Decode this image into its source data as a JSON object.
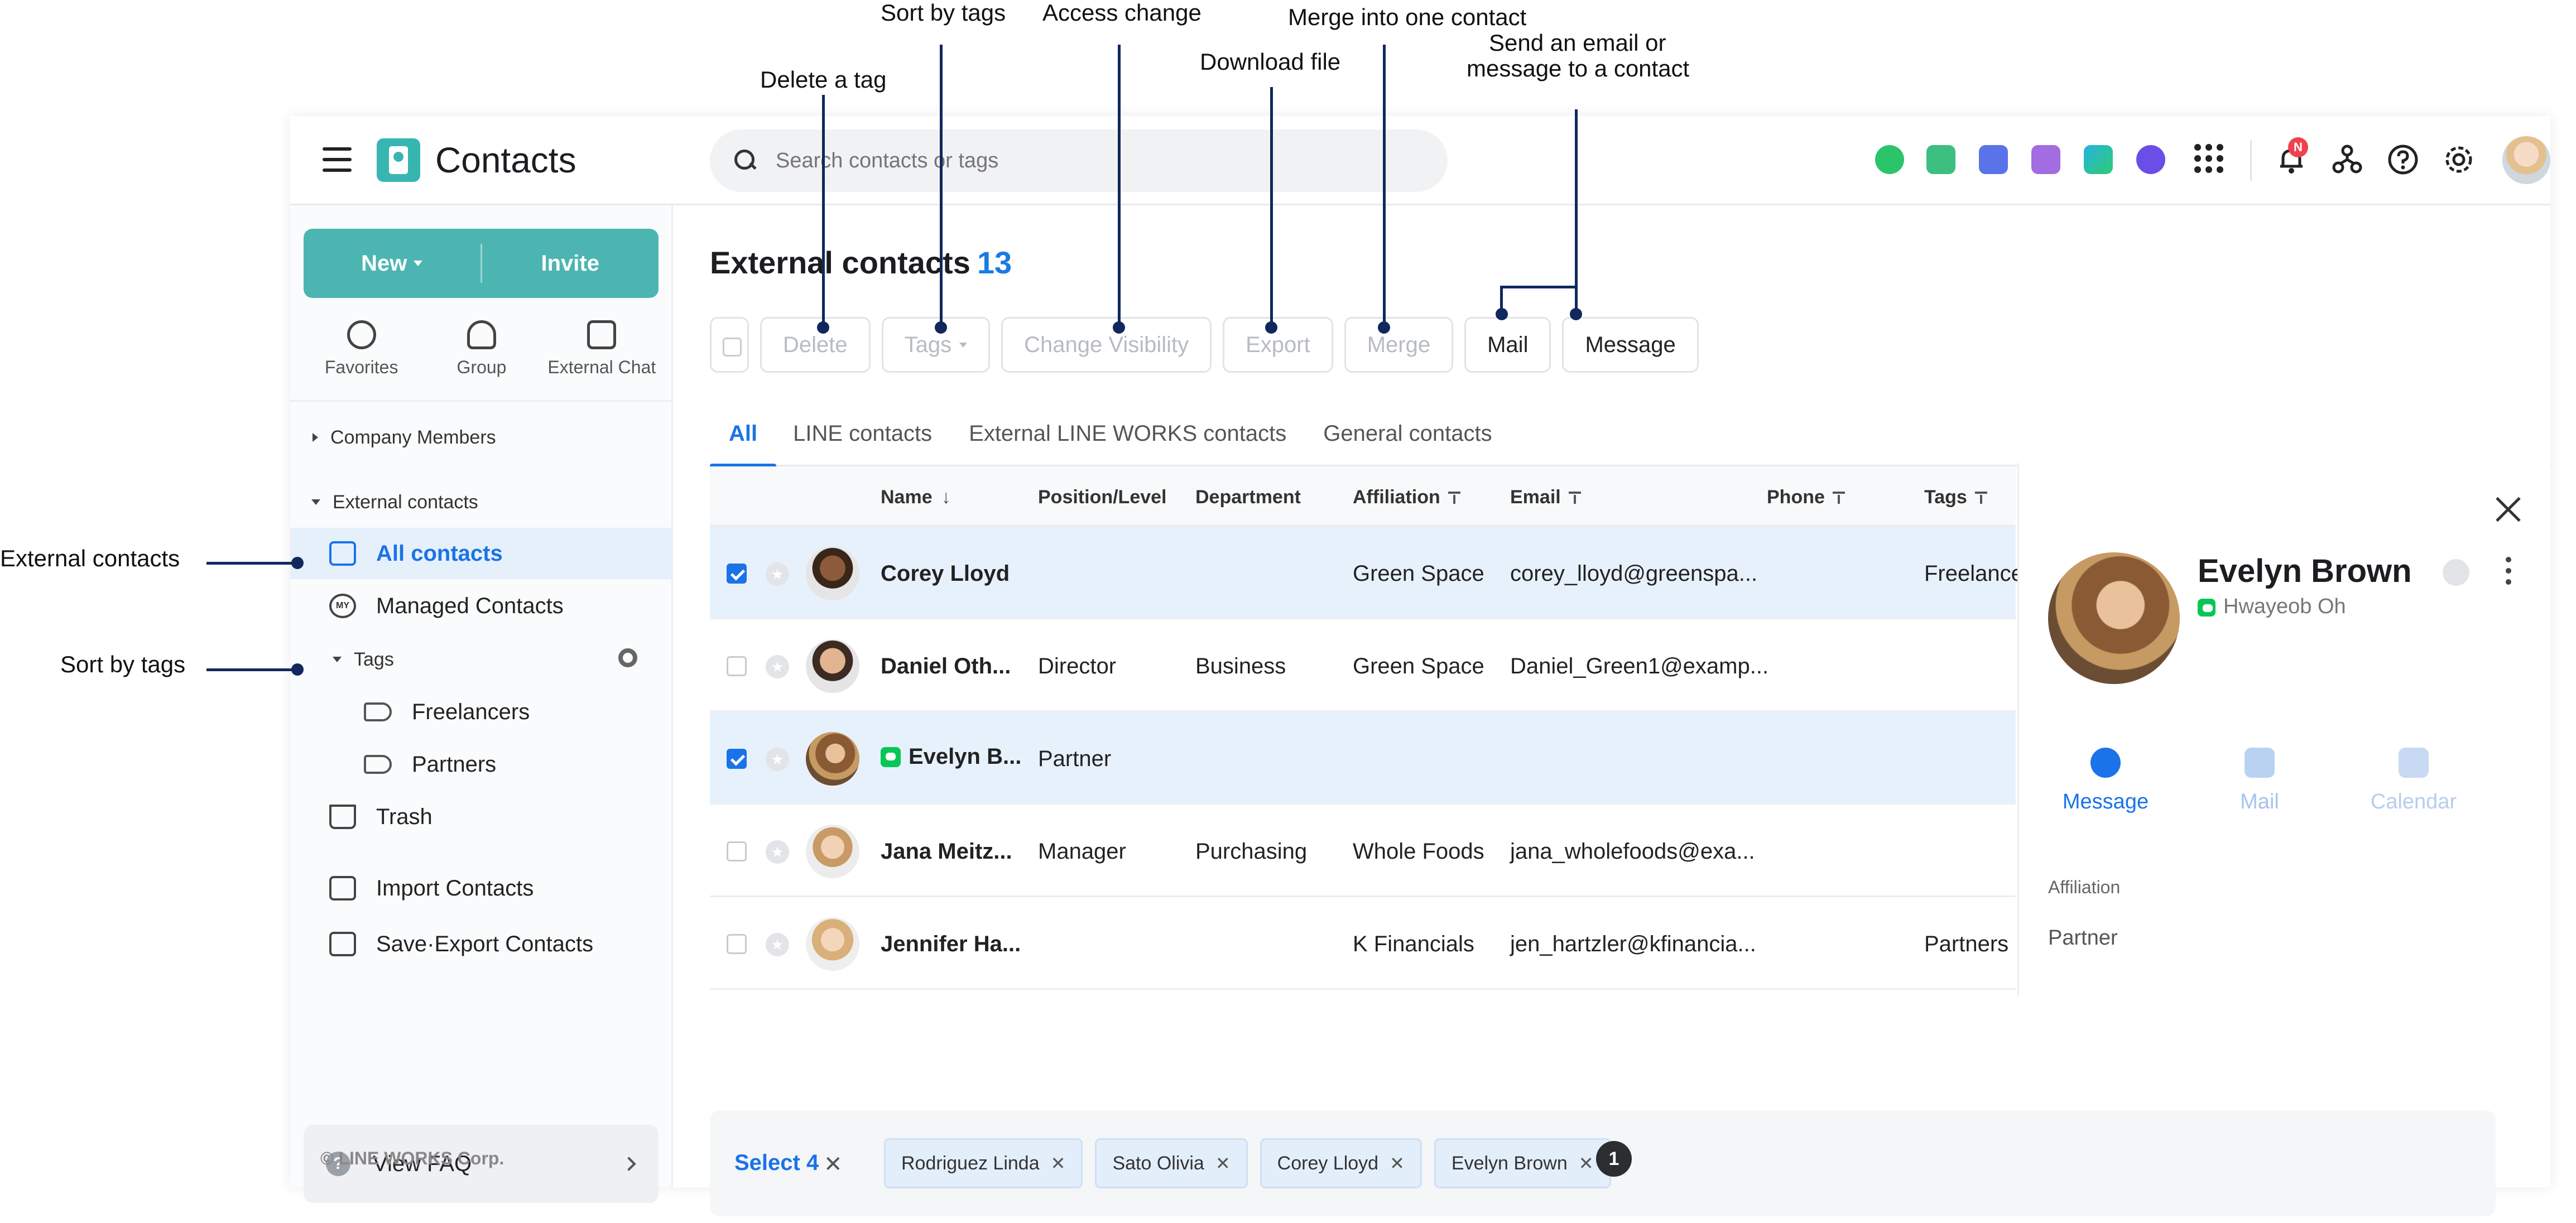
{
  "annotations": {
    "delete_tag": "Delete a tag",
    "sort_by_tags_top": "Sort by tags",
    "access_change": "Access change",
    "download_file": "Download file",
    "merge_contact": "Merge into one contact",
    "send_email_line1": "Send an email or",
    "send_email_line2": "message to a contact",
    "external_contacts": "External contacts",
    "sort_by_tags_left": "Sort by tags"
  },
  "header": {
    "app_title": "Contacts",
    "search_placeholder": "Search contacts or tags",
    "notification_badge": "N",
    "app_icons": [
      "talk-icon",
      "mail-icon",
      "calendar-icon",
      "note-icon",
      "drive-icon",
      "task-icon"
    ]
  },
  "sidebar": {
    "new_label": "New",
    "invite_label": "Invite",
    "shortcuts": [
      {
        "label": "Favorites",
        "icon": "star-icon"
      },
      {
        "label": "Group",
        "icon": "group-icon"
      },
      {
        "label": "External Chat",
        "icon": "external-chat-icon"
      }
    ],
    "company_members": "Company Members",
    "external_contacts": "External contacts",
    "all_contacts": "All contacts",
    "managed_contacts": "Managed Contacts",
    "managed_badge": "MY",
    "tags": "Tags",
    "tag_items": [
      "Freelancers",
      "Partners"
    ],
    "trash": "Trash",
    "import_contacts": "Import Contacts",
    "save_export_contacts": "Save·Export Contacts",
    "view_faq": "View FAQ",
    "copyright": "© LINE WORKS Corp."
  },
  "main": {
    "title": "External contacts",
    "count": "13",
    "toolbar": {
      "delete": "Delete",
      "tags": "Tags",
      "change_visibility": "Change Visibility",
      "export": "Export",
      "merge": "Merge",
      "mail": "Mail",
      "message": "Message"
    },
    "tabs": [
      "All",
      "LINE contacts",
      "External LINE WORKS contacts",
      "General contacts"
    ],
    "columns": [
      "Name",
      "Position/Level",
      "Department",
      "Affiliation",
      "Email",
      "Phone",
      "Tags"
    ],
    "rows": [
      {
        "name": "Corey Lloyd",
        "position": "",
        "department": "",
        "affiliation": "Green Space",
        "email": "corey_lloyd@greenspa...",
        "tags": "Freelance",
        "checked": true,
        "line": false
      },
      {
        "name": "Daniel Oth...",
        "position": "Director",
        "department": "Business",
        "affiliation": "Green Space",
        "email": "Daniel_Green1@examp...",
        "tags": "",
        "checked": false,
        "line": false
      },
      {
        "name": "Evelyn B...",
        "position": "Partner",
        "department": "",
        "affiliation": "",
        "email": "",
        "tags": "",
        "checked": true,
        "line": true
      },
      {
        "name": "Jana Meitz...",
        "position": "Manager",
        "department": "Purchasing",
        "affiliation": "Whole Foods",
        "email": "jana_wholefoods@exa...",
        "tags": "",
        "checked": false,
        "line": false
      },
      {
        "name": "Jennifer Ha...",
        "position": "",
        "department": "",
        "affiliation": "K Financials",
        "email": "jen_hartzler@kfinancia...",
        "tags": "Partners",
        "checked": false,
        "line": false
      }
    ],
    "selection": {
      "label": "Select 4",
      "chips": [
        "Rodriguez Linda",
        "Sato Olivia",
        "Corey Lloyd",
        "Evelyn Brown"
      ]
    },
    "page": "1"
  },
  "detail": {
    "name": "Evelyn Brown",
    "sub": "Hwayeob Oh",
    "actions": [
      {
        "label": "Message",
        "enabled": true
      },
      {
        "label": "Mail",
        "enabled": false
      },
      {
        "label": "Calendar",
        "enabled": false
      }
    ],
    "field_label": "Affiliation",
    "field_value": "Partner"
  },
  "colors": {
    "accent": "#1a73e8",
    "brand_teal": "#4cb5b1",
    "annotation_line": "#10285c",
    "selected_row": "#e7f1fc"
  }
}
